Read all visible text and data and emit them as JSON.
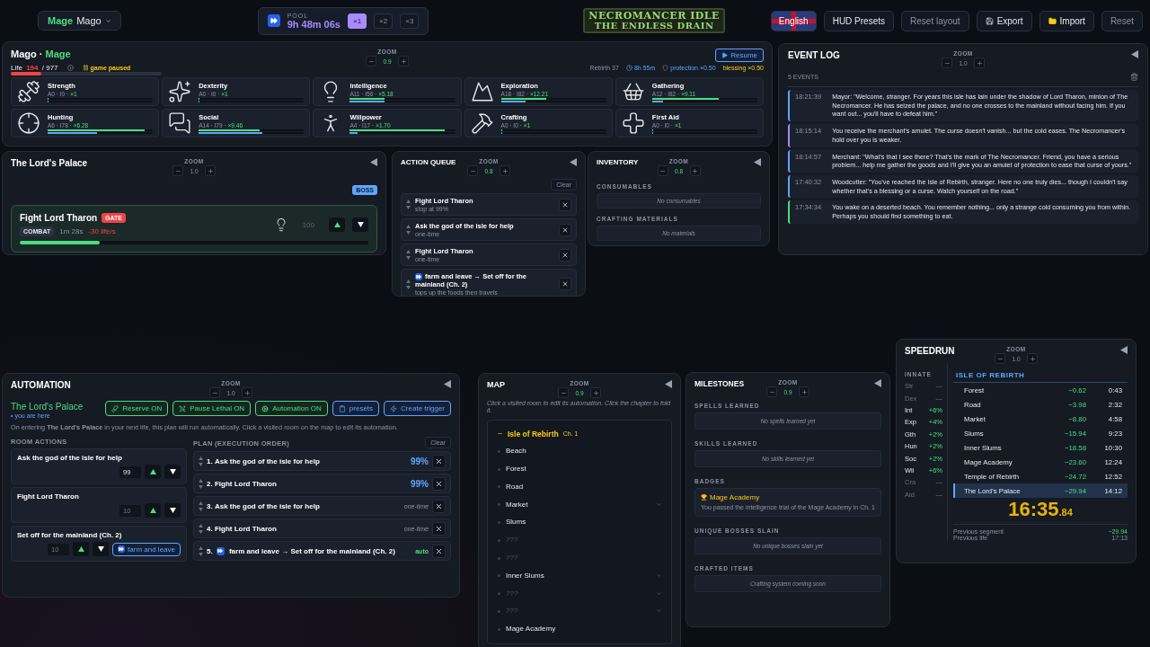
{
  "header": {
    "character": {
      "class": "Mage",
      "name": "Mago"
    },
    "pool": {
      "label": "POOL",
      "time": "9h 48m 06s",
      "speeds": [
        {
          "label": "×1",
          "selected": true
        },
        {
          "label": "×2",
          "selected": false
        },
        {
          "label": "×3",
          "selected": false
        }
      ]
    },
    "logo": {
      "line1": "NECROMANCER IDLE",
      "line2": "THE ENDLESS DRAIN"
    },
    "language": "English",
    "buttons": [
      {
        "label": "HUD Presets",
        "kind": "plain"
      },
      {
        "label": "Reset layout",
        "kind": "dim"
      },
      {
        "label": "Export",
        "kind": "export"
      },
      {
        "label": "Import",
        "kind": "import"
      },
      {
        "label": "Reset",
        "kind": "dim"
      }
    ]
  },
  "character_panel": {
    "name": "Mago",
    "separator": "·",
    "class": "Mage",
    "zoom": {
      "label": "ZOOM",
      "value": "0.9",
      "changed": true
    },
    "resume": "Resume",
    "life": {
      "label": "Life",
      "current": "194",
      "separator": "/",
      "max": "977",
      "level": 0.2
    },
    "paused": "game paused",
    "stats": {
      "rebirth": "Rebirth 37",
      "time": "8h 55m",
      "protection": "protection ×0.50",
      "blessing": "blessing ×0.50"
    },
    "skills": [
      {
        "name": "Strength",
        "stats": "A0 · I0 ·",
        "multiplier": "×1",
        "bars": [
          {
            "level": 0.01
          },
          {
            "level": 0.01
          }
        ]
      },
      {
        "name": "Dexterity",
        "stats": "A0 · I0 ·",
        "multiplier": "×1",
        "bars": [
          {
            "level": 0.01
          },
          {
            "level": 0.01
          }
        ]
      },
      {
        "name": "Intelligence",
        "stats": "A11 · I56 ·",
        "multiplier": "×5.18",
        "bars": [
          {
            "level": 0.33
          },
          {
            "level": 0.33
          }
        ]
      },
      {
        "name": "Exploration",
        "stats": "A18 · I82 ·",
        "multiplier": "×12.21",
        "bars": [
          {
            "level": 0.43
          },
          {
            "level": 0.23
          }
        ]
      },
      {
        "name": "Gathering",
        "stats": "A12 · I82 ·",
        "multiplier": "×9.11",
        "bars": [
          {
            "level": 0.63
          },
          {
            "level": 0.1
          }
        ]
      },
      {
        "name": "Hunting",
        "stats": "A6 · I78 ·",
        "multiplier": "×6.28",
        "bars": [
          {
            "level": 0.92
          },
          {
            "level": 0.47
          }
        ]
      },
      {
        "name": "Social",
        "stats": "A14 · I79 ·",
        "multiplier": "×9.46",
        "bars": [
          {
            "level": 0.58
          },
          {
            "level": 0.6
          }
        ]
      },
      {
        "name": "Willpower",
        "stats": "A4 · I17 ·",
        "multiplier": "×1.70",
        "bars": [
          {
            "level": 0.9
          },
          {
            "level": 0.07
          }
        ]
      },
      {
        "name": "Crafting",
        "stats": "A0 · I0 ·",
        "multiplier": "×1",
        "bars": [
          {
            "level": 0.01
          },
          {
            "level": 0.01
          }
        ]
      },
      {
        "name": "First Aid",
        "stats": "A0 · I0 ·",
        "multiplier": "×1",
        "bars": [
          {
            "level": 0.01
          },
          {
            "level": 0.01
          }
        ]
      }
    ]
  },
  "palace": {
    "title": "The Lord's Palace",
    "zoom": {
      "label": "ZOOM",
      "value": "1.0",
      "changed": false
    },
    "tag": "BOSS",
    "action": {
      "name": "Fight Lord Tharon",
      "tag": "GATE",
      "type": "COMBAT",
      "duration": "1m 28s",
      "drain": "-30 life/s",
      "count": "100",
      "level": 0.23
    }
  },
  "action_queue": {
    "title": "ACTION QUEUE",
    "zoom": {
      "label": "ZOOM",
      "value": "0.8",
      "changed": true
    },
    "clear": "Clear",
    "items": [
      {
        "name": "Fight Lord Tharon",
        "note": "stop at 99%",
        "kind": "plain"
      },
      {
        "name": "Ask the god of the isle for help",
        "note": "one-time",
        "kind": "plain"
      },
      {
        "name": "Fight Lord Tharon",
        "note": "one-time",
        "kind": "plain"
      },
      {
        "name": "farm and leave → Set off for the mainland (Ch. 2)",
        "note": "tops up the foods then travels",
        "kind": "farm"
      }
    ]
  },
  "inventory": {
    "title": "INVENTORY",
    "zoom": {
      "label": "ZOOM",
      "value": "0.8",
      "changed": true
    },
    "sections": [
      {
        "title": "CONSUMABLES",
        "empty": "No consumables"
      },
      {
        "title": "CRAFTING MATERIALS",
        "empty": "No materials"
      }
    ]
  },
  "event_log": {
    "title": "EVENT LOG",
    "zoom": {
      "label": "ZOOM",
      "value": "1.0",
      "changed": false
    },
    "count": "5 EVENTS",
    "events": [
      {
        "time": "18:21:39",
        "text": "Mayor: \"Welcome, stranger. For years this isle has lain under the shadow of Lord Tharon, minion of The Necromancer. He has seized the palace, and no one crosses to the mainland without facing him. If you want out... you'll have to defeat him.\"",
        "color": "#60a5fa"
      },
      {
        "time": "18:15:14",
        "text": "You receive the merchant's amulet. The curse doesn't vanish... but the cold eases. The Necromancer's hold over you is weaker.",
        "color": "#a78bfa"
      },
      {
        "time": "18:14:57",
        "text": "Merchant: \"What's that I see there? That's the mark of The Necromancer. Friend, you have a serious problem... help me gather the goods and I'll give you an amulet of protection to ease that curse of yours.\"",
        "color": "#60a5fa"
      },
      {
        "time": "17:40:32",
        "text": "Woodcutter: \"You've reached the Isle of Rebirth, stranger. Here no one truly dies... though I couldn't say whether that's a blessing or a curse. Watch yourself on the road.\"",
        "color": "#60a5fa"
      },
      {
        "time": "17:34:34",
        "text": "You wake on a deserted beach. You remember nothing... only a strange cold consuming you from within. Perhaps you should find something to eat.",
        "color": "#4ade80"
      }
    ]
  },
  "automation": {
    "title": "AUTOMATION",
    "zoom": {
      "label": "ZOOM",
      "value": "1.0",
      "changed": false
    },
    "room": "The Lord's Palace",
    "here": "• you are here",
    "toggles": [
      {
        "label": "Reserve ON",
        "kind": "reserve"
      },
      {
        "label": "Pause Lethal ON",
        "kind": "lethal"
      },
      {
        "label": "Automation ON",
        "kind": "auto"
      },
      {
        "label": "presets",
        "kind": "presets"
      },
      {
        "label": "Create trigger",
        "kind": "trigger"
      }
    ],
    "description": "On entering **The Lord's Palace** in your next life, this plan will run automatically. Click a visited room on the map to edit its automation.",
    "room_actions_title": "ROOM ACTIONS",
    "plan_title": "PLAN (EXECUTION ORDER)",
    "clear": "Clear",
    "room_actions": [
      {
        "name": "Ask the god of the isle for help",
        "value": "99",
        "active": true
      },
      {
        "name": "Fight Lord Tharon",
        "value": "10",
        "active": false
      },
      {
        "name": "Set off for the mainland (Ch. 2)",
        "value": "10",
        "active": false,
        "farm": "farm and leave"
      }
    ],
    "plan": [
      {
        "number": "1.",
        "name": "Ask the god of the isle for help",
        "tag": "99%",
        "kind": "percent"
      },
      {
        "number": "2.",
        "name": "Fight Lord Tharon",
        "tag": "99%",
        "kind": "percent"
      },
      {
        "number": "3.",
        "name": "Ask the god of the isle for help",
        "tag": "one-time",
        "kind": "once"
      },
      {
        "number": "4.",
        "name": "Fight Lord Tharon",
        "tag": "one-time",
        "kind": "once"
      },
      {
        "number": "5.",
        "name": "farm and leave → Set off for the mainland (Ch. 2)",
        "tag": "auto",
        "kind": "auto"
      }
    ]
  },
  "map": {
    "title": "MAP",
    "zoom": {
      "label": "ZOOM",
      "value": "0.9",
      "changed": true
    },
    "hint": "Click a visited room to edit its automation. Click the chapter to fold it.",
    "chapter": {
      "name": "Isle of Rebirth",
      "number": "Ch. 1",
      "expanded": true
    },
    "rooms": [
      {
        "name": "Beach",
        "discovered": true,
        "collapsible": false
      },
      {
        "name": "Forest",
        "discovered": true,
        "collapsible": false
      },
      {
        "name": "Road",
        "discovered": true,
        "collapsible": false
      },
      {
        "name": "Market",
        "discovered": true,
        "collapsible": true
      },
      {
        "name": "Slums",
        "discovered": true,
        "collapsible": false
      },
      {
        "name": "???",
        "discovered": false,
        "collapsible": false
      },
      {
        "name": "???",
        "discovered": false,
        "collapsible": false
      },
      {
        "name": "Inner Slums",
        "discovered": true,
        "collapsible": true
      },
      {
        "name": "???",
        "discovered": false,
        "collapsible": true
      },
      {
        "name": "???",
        "discovered": false,
        "collapsible": true
      },
      {
        "name": "Mage Academy",
        "discovered": true,
        "collapsible": false
      }
    ]
  },
  "milestones": {
    "title": "MILESTONES",
    "zoom": {
      "label": "ZOOM",
      "value": "0.9",
      "changed": true
    },
    "sections": [
      {
        "title": "SPELLS LEARNED",
        "kind": "empty",
        "text": "No spells learned yet"
      },
      {
        "title": "SKILLS LEARNED",
        "kind": "empty",
        "text": "No skills learned yet"
      },
      {
        "title": "BADGES",
        "kind": "badge",
        "badge": "Mage Academy",
        "text": "You passed the intelligence trial of the Mage Academy in Ch. 1"
      },
      {
        "title": "UNIQUE BOSSES SLAIN",
        "kind": "empty",
        "text": "No unique bosses slain yet"
      },
      {
        "title": "CRAFTED ITEMS",
        "kind": "empty",
        "text": "Crafting system coming soon"
      }
    ]
  },
  "speedrun": {
    "title": "SPEEDRUN",
    "zoom": {
      "label": "ZOOM",
      "value": "1.0",
      "changed": false
    },
    "innate_title": "INNATE",
    "innate": [
      {
        "stat": "Str",
        "bonus": "—",
        "active": false
      },
      {
        "stat": "Dex",
        "bonus": "—",
        "active": false
      },
      {
        "stat": "Int",
        "bonus": "+6%",
        "active": true
      },
      {
        "stat": "Exp",
        "bonus": "+4%",
        "active": true
      },
      {
        "stat": "Gth",
        "bonus": "+2%",
        "active": true
      },
      {
        "stat": "Hun",
        "bonus": "+2%",
        "active": true
      },
      {
        "stat": "Soc",
        "bonus": "+2%",
        "active": true
      },
      {
        "stat": "Wil",
        "bonus": "+6%",
        "active": true
      },
      {
        "stat": "Cra",
        "bonus": "—",
        "active": false
      },
      {
        "stat": "Aid",
        "bonus": "—",
        "active": false
      }
    ],
    "chapter": "ISLE OF REBIRTH",
    "splits": [
      {
        "name": "Forest",
        "delta": "−0.62",
        "time": "0:43",
        "selected": false
      },
      {
        "name": "Road",
        "delta": "−3.98",
        "time": "2:32",
        "selected": false
      },
      {
        "name": "Market",
        "delta": "−8.80",
        "time": "4:58",
        "selected": false
      },
      {
        "name": "Slums",
        "delta": "−15.94",
        "time": "9:23",
        "selected": false
      },
      {
        "name": "Inner Slums",
        "delta": "−18.58",
        "time": "10:30",
        "selected": false
      },
      {
        "name": "Mage Academy",
        "delta": "−23.60",
        "time": "12:24",
        "selected": false
      },
      {
        "name": "Temple of Rebirth",
        "delta": "−24.72",
        "time": "12:52",
        "selected": false
      },
      {
        "name": "The Lord's Palace",
        "delta": "−29.94",
        "time": "14:12",
        "selected": true
      }
    ],
    "timer": {
      "main": "16:35",
      "fraction": ".84"
    },
    "footer": [
      {
        "label": "Previous segment",
        "value": "−29.94",
        "kind": "delta"
      },
      {
        "label": "Previous life",
        "value": "17:13",
        "kind": "time"
      }
    ]
  }
}
